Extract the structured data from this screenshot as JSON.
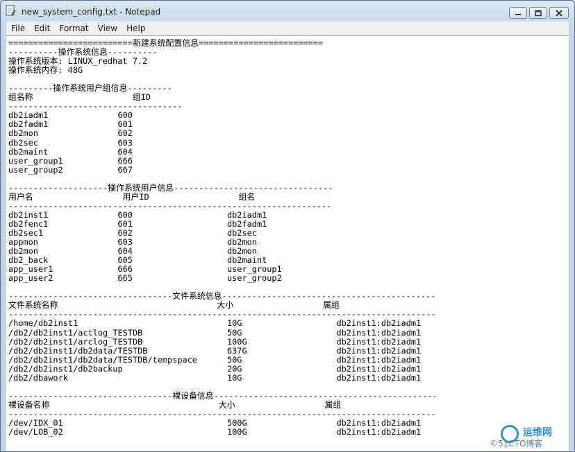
{
  "window": {
    "title": "new_system_config.txt - Notepad"
  },
  "menu": {
    "file": "File",
    "edit": "Edit",
    "format": "Format",
    "view": "View",
    "help": "Help"
  },
  "document": {
    "text": "=========================新建系统配置信息=========================\n----------操作系统信息----------\n操作系统版本: LINUX_redhat 7.2\n操作系统内存: 48G\n\n---------操作系统用户组信息---------\n组名称                    组ID\n-----------------------------------\ndb2iadm1              600\ndb2fadm1              601\ndb2mon                602\ndb2sec                603\ndb2maint              604\nuser_group1           666\nuser_group2           667\n\n--------------------操作系统用户信息--------------------------------\n用户名                  用户ID                  组名\n-----------------------------------------------------------------\ndb2inst1              600                   db2iadm1\ndb2fenc1              601                   db2fadm1\ndb2sec1               602                   db2sec\nappmon                603                   db2mon\ndb2mon                604                   db2mon\ndb2_back              605                   db2maint\napp_user1             666                   user_group1\napp_user2             665                   user_group2\n\n---------------------------------文件系统信息-------------------------------------------\n文件系统名称                                大小                  属组\n--------------------------------------------------------------------------------------\n/home/db2inst1                              10G                   db2inst1:db2iadm1\n/db2/db2inst1/actlog_TESTDB                 50G                   db2inst1:db2iadm1\n/db2/db2inst1/arclog_TESTDB                 100G                  db2inst1:db2iadm1\n/db2/db2inst1/db2data/TESTDB                637G                  db2inst1:db2iadm1\n/db2/db2inst1/db2data/TESTDB/tempspace      50G                   db2inst1:db2iadm1\n/db2/db2inst1/db2backup                     20G                   db2inst1:db2iadm1\n/db2/dbawork                                10G                   db2inst1:db2iadm1\n\n---------------------------------裸设备信息---------------------------------------------\n裸设备名称                                  大小                  属组\n--------------------------------------------------------------------------------------\n/dev/IDX_01                                 500G                  db2inst1:db2iadm1\n/dev/LOB_02                                 100G                  db2inst1:db2iadm1"
  },
  "watermark": {
    "line1": "运维网",
    "line2": "©51CTO博客"
  },
  "colors": {
    "titlebar": "#dce7f3",
    "editor_bg": "#ffffff",
    "watermark": "#2b8fd6"
  }
}
